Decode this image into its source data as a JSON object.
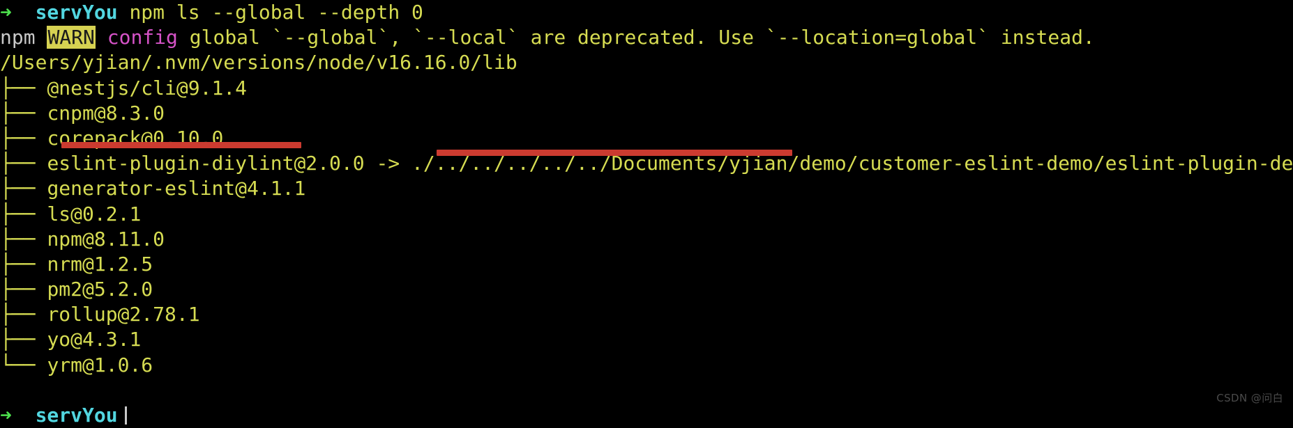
{
  "terminal": {
    "background_color": "#000000",
    "foreground_color": "#d6dc52",
    "prompt_symbol": "➜",
    "prompt_host": "servYou",
    "watermark": "CSDN @问白",
    "cursor_visible": true
  },
  "command_line": {
    "prompt_symbol": "➜",
    "host": "servYou",
    "command": "npm ls --global --depth 0"
  },
  "warning_line": {
    "prefix": "npm",
    "badge": "WARN",
    "scope": "config",
    "key": "global",
    "message": "`--global`, `--local` are deprecated. Use `--location=global` instead."
  },
  "root_path": "/Users/yjian/.nvm/versions/node/v16.16.0/lib",
  "packages": [
    {
      "branch": "├──",
      "name": "@nestjs/cli@9.1.4",
      "link": ""
    },
    {
      "branch": "├──",
      "name": "cnpm@8.3.0",
      "link": ""
    },
    {
      "branch": "├──",
      "name": "corepack@0.10.0",
      "link": ""
    },
    {
      "branch": "├──",
      "name": "eslint-plugin-diylint@2.0.0",
      "link": " -> ./../../../../../Documents/yjian/demo/customer-eslint-demo/eslint-plugin-demo"
    },
    {
      "branch": "├──",
      "name": "generator-eslint@4.1.1",
      "link": ""
    },
    {
      "branch": "├──",
      "name": "ls@0.2.1",
      "link": ""
    },
    {
      "branch": "├──",
      "name": "npm@8.11.0",
      "link": ""
    },
    {
      "branch": "├──",
      "name": "nrm@1.2.5",
      "link": ""
    },
    {
      "branch": "├──",
      "name": "pm2@5.2.0",
      "link": ""
    },
    {
      "branch": "├──",
      "name": "rollup@2.78.1",
      "link": ""
    },
    {
      "branch": "├──",
      "name": "yo@4.3.1",
      "link": ""
    },
    {
      "branch": "└──",
      "name": "yrm@1.0.6",
      "link": ""
    }
  ],
  "annotations": [
    {
      "id": "anno-1",
      "color": "#cc3b30",
      "target": "eslint-plugin-diylint@2.0.0"
    },
    {
      "id": "anno-2",
      "color": "#cc3b30",
      "target": "Documents/yjian/demo/customer-eslint-demo"
    }
  ]
}
